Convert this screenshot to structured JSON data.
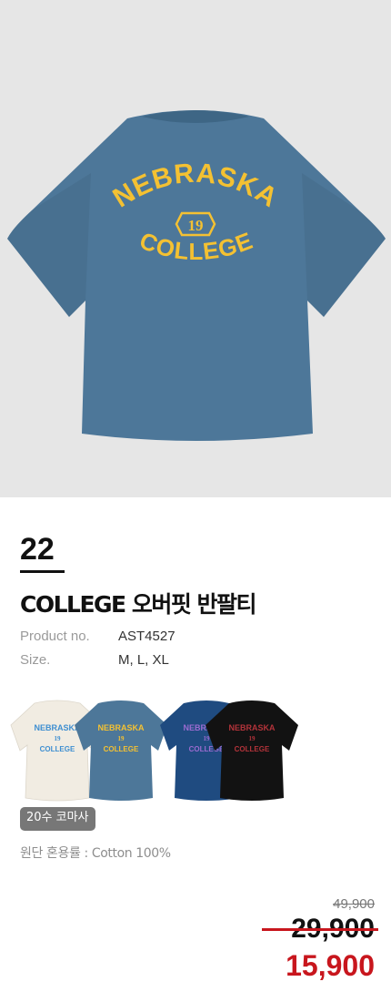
{
  "hero": {
    "shirt_color": "#4d7799",
    "print": {
      "top_text": "NEBRASKA",
      "badge_text": "19",
      "bottom_text": "COLLEGE",
      "print_color": "#f4c132"
    }
  },
  "product": {
    "number": "22",
    "title": "COLLEGE 오버핏 반팔티",
    "specs": [
      {
        "label": "Product no.",
        "value": "AST4527"
      },
      {
        "label": "Size.",
        "value": "M, L, XL"
      }
    ]
  },
  "variants": [
    {
      "name": "ivory",
      "shirt": "#f1ece2",
      "print": "#3f8fd1"
    },
    {
      "name": "blue",
      "shirt": "#4d7799",
      "print": "#f4c132"
    },
    {
      "name": "navy",
      "shirt": "#1f4b80",
      "print": "#9b6bd0"
    },
    {
      "name": "black",
      "shirt": "#121212",
      "print": "#b3333a"
    }
  ],
  "material": {
    "badge": "20수 코마사",
    "fabric": "원단 혼용률 : Cotton 100%"
  },
  "price": {
    "original": "49,900",
    "previous": "29,900",
    "final": "15,900",
    "sale_color": "#c8161d"
  }
}
